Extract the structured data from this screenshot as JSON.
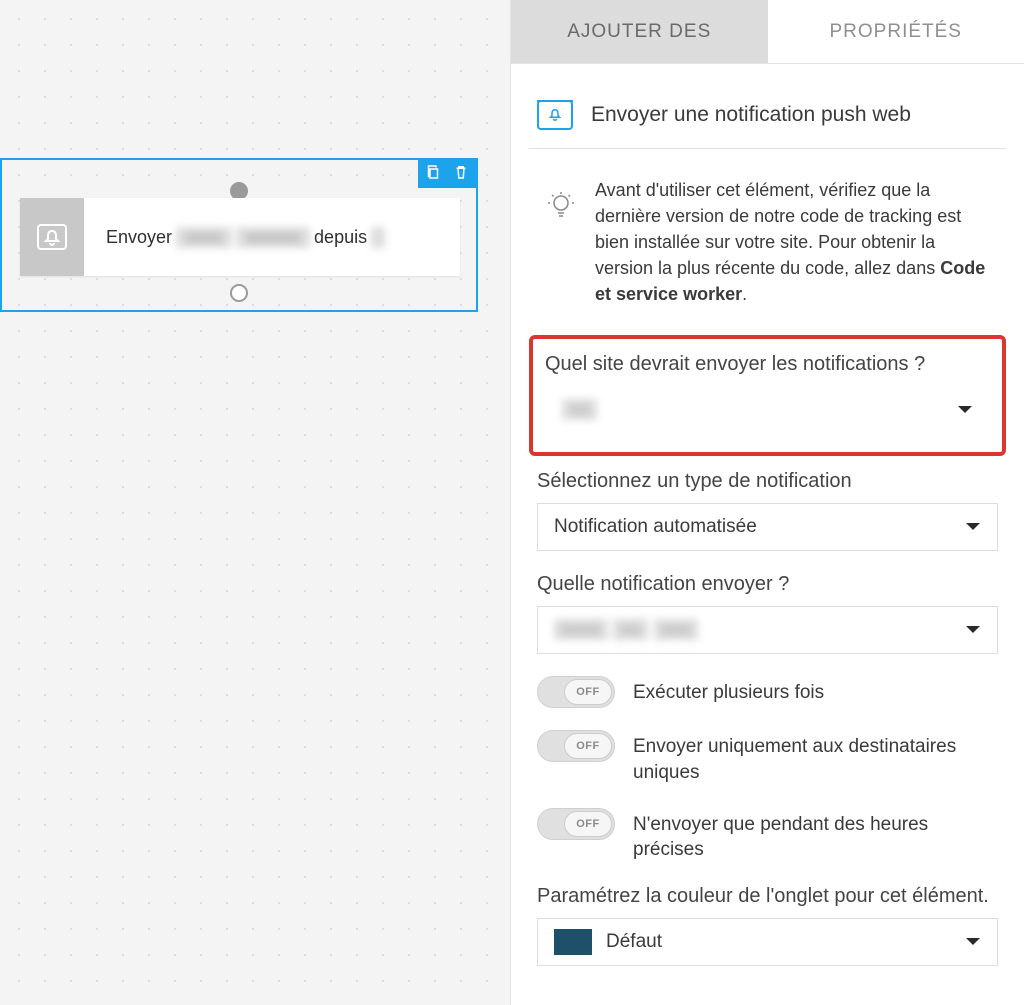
{
  "tabs": {
    "add": "AJOUTER DES",
    "props": "PROPRIÉTÉS"
  },
  "canvas_node": {
    "prefix": "Envoyer",
    "suffix": "depuis"
  },
  "header": {
    "title": "Envoyer une notification push web"
  },
  "tip": {
    "text_before": "Avant d'utiliser cet élément, vérifiez que la dernière version de notre code de tracking est bien installée sur votre site. Pour obtenir la version la plus récente du code, allez dans ",
    "strong": "Code et service worker",
    "text_after": "."
  },
  "form": {
    "site_label": "Quel site devrait envoyer les notifications ?",
    "site_value": "",
    "type_label": "Sélectionnez un type de notification",
    "type_value": "Notification automatisée",
    "which_label": "Quelle notification envoyer ?",
    "which_value": "",
    "toggle_off": "OFF",
    "t1": "Exécuter plusieurs fois",
    "t2": "Envoyer uniquement aux destinataires uniques",
    "t3": "N'envoyer que pendant des heures précises",
    "color_label": "Paramétrez la couleur de l'onglet pour cet élément.",
    "color_value": "Défaut",
    "color_hex": "#1e5069"
  }
}
